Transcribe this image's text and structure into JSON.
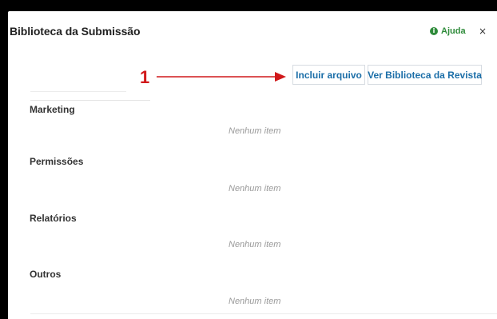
{
  "modal": {
    "title": "Biblioteca da Submissão",
    "help_label": "Ajuda",
    "help_icon_glyph": "i",
    "close_glyph": "×"
  },
  "toolbar": {
    "include_file_label": "Incluir arquivo",
    "view_library_label": "Ver Biblioteca da Revista"
  },
  "annotation": {
    "number": "1",
    "color": "#d1191b"
  },
  "sections": [
    {
      "label": "Marketing",
      "empty": "Nenhum item"
    },
    {
      "label": "Permissões",
      "empty": "Nenhum item"
    },
    {
      "label": "Relatórios",
      "empty": "Nenhum item"
    },
    {
      "label": "Outros",
      "empty": "Nenhum item"
    }
  ],
  "colors": {
    "accent_link": "#1b6ea8",
    "help_green": "#2e8b3a",
    "muted_text": "#9a9a9a"
  }
}
